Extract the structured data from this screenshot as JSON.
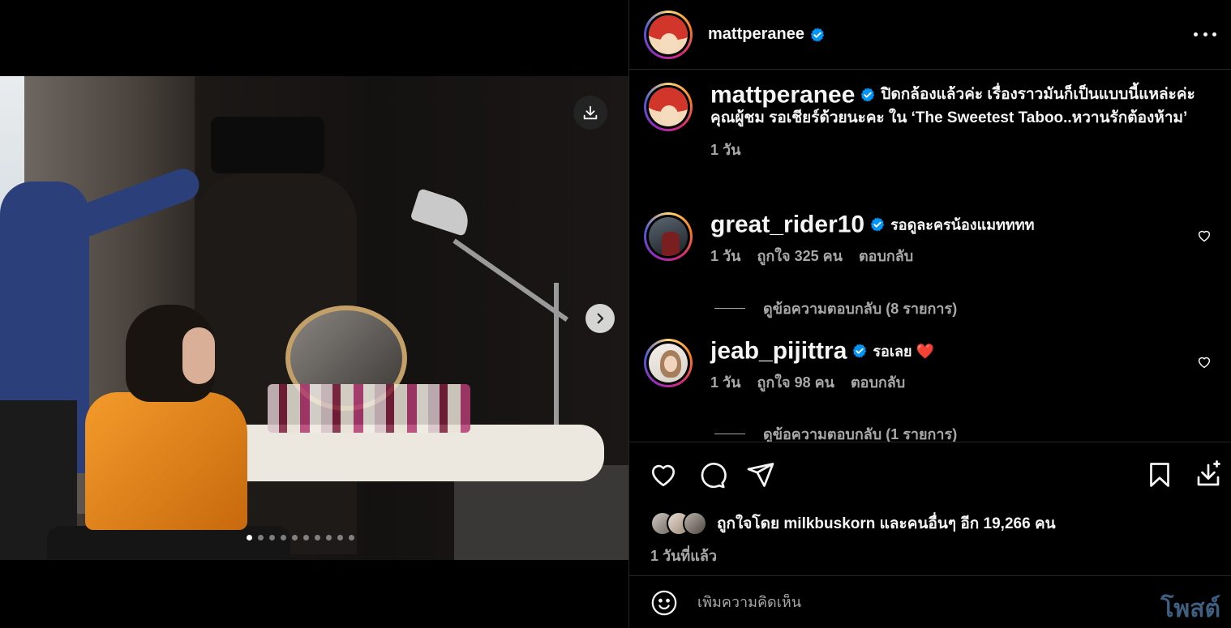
{
  "post": {
    "author": "mattperanee",
    "caption": "ปิดกล้องแล้วค่ะ เรื่องราวมันก็เป็นแบบนี้แหล่ะค่ะคุณผู้ชม รอเชียร์ด้วยนะคะ ใน ‘The Sweetest Taboo..หวานรักต้องห้าม’",
    "caption_time": "1 วัน"
  },
  "media": {
    "slide_count": 10,
    "active_slide": 0
  },
  "comments": [
    {
      "username": "great_rider10",
      "text": "รอดูละครน้องแมทททท",
      "time": "1 วัน",
      "likes": "ถูกใจ 325 คน",
      "reply": "ตอบกลับ",
      "view_replies": "ดูข้อความตอบกลับ (8 รายการ)"
    },
    {
      "username": "jeab_pijittra",
      "text": "รอเลย ❤️",
      "time": "1 วัน",
      "likes": "ถูกใจ 98 คน",
      "reply": "ตอบกลับ",
      "view_replies": "ดูข้อความตอบกลับ (1 รายการ)"
    }
  ],
  "engagement": {
    "liked_by_prefix": "ถูกใจโดย",
    "liked_by_user": "milkbuskorn",
    "liked_by_and": "และ",
    "liked_by_others": "คนอื่นๆ",
    "liked_by_count": "อีก 19,266 คน",
    "posted_ago": "1 วันที่แล้ว"
  },
  "composer": {
    "placeholder": "เพิ่มความคิดเห็น",
    "post_label": "โพสต์"
  },
  "colors": {
    "verified": "#0095f6",
    "heart_red": "#e0245e",
    "muted": "#a8a8a8"
  }
}
